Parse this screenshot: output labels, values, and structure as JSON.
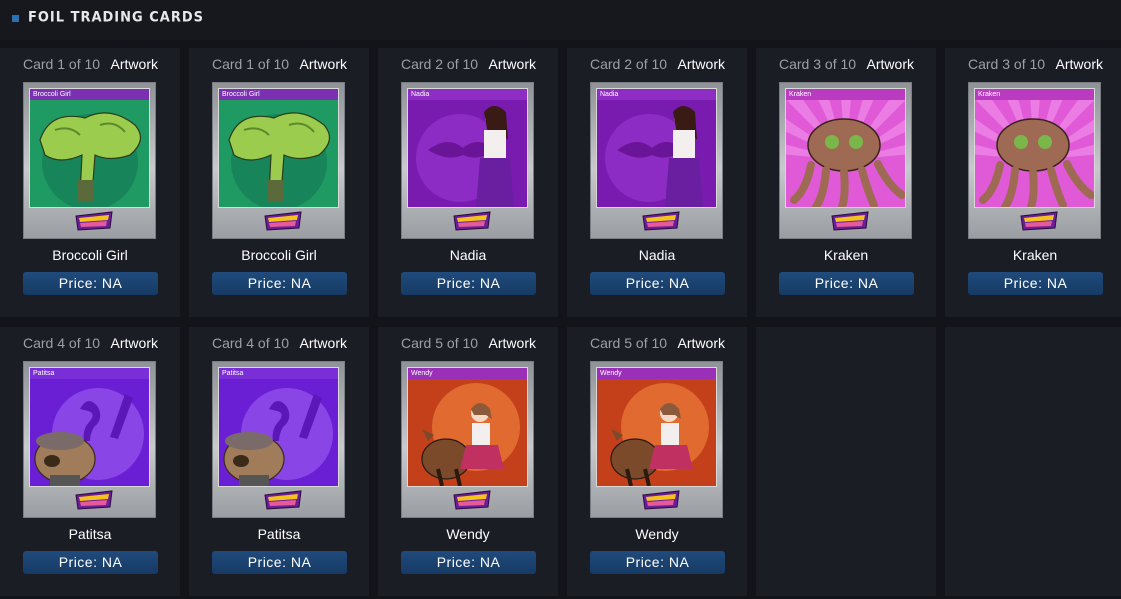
{
  "header": {
    "title": "FOIL TRADING CARDS"
  },
  "cards": [
    {
      "number": "Card 1 of 10",
      "artwork": "Artwork",
      "name": "Broccoli Girl",
      "price": "Price: NA",
      "theme": "broccoli",
      "bg": "#1f9a63",
      "bar": "#7b2fb1"
    },
    {
      "number": "Card 1 of 10",
      "artwork": "Artwork",
      "name": "Broccoli Girl",
      "price": "Price: NA",
      "theme": "broccoli",
      "bg": "#1f9a63",
      "bar": "#7b2fb1"
    },
    {
      "number": "Card 2 of 10",
      "artwork": "Artwork",
      "name": "Nadia",
      "price": "Price: NA",
      "theme": "nadia",
      "bg": "#7a1bb0",
      "bar": "#8e2dc4"
    },
    {
      "number": "Card 2 of 10",
      "artwork": "Artwork",
      "name": "Nadia",
      "price": "Price: NA",
      "theme": "nadia",
      "bg": "#7a1bb0",
      "bar": "#8e2dc4"
    },
    {
      "number": "Card 3 of 10",
      "artwork": "Artwork",
      "name": "Kraken",
      "price": "Price: NA",
      "theme": "kraken",
      "bg": "#e05ad8",
      "bar": "#b93cc0"
    },
    {
      "number": "Card 3 of 10",
      "artwork": "Artwork",
      "name": "Kraken",
      "price": "Price: NA",
      "theme": "kraken",
      "bg": "#e05ad8",
      "bar": "#b93cc0"
    },
    {
      "number": "Card 4 of 10",
      "artwork": "Artwork",
      "name": "Patitsa",
      "price": "Price: NA",
      "theme": "patitsa",
      "bg": "#6a1fd4",
      "bar": "#7a2ed8"
    },
    {
      "number": "Card 4 of 10",
      "artwork": "Artwork",
      "name": "Patitsa",
      "price": "Price: NA",
      "theme": "patitsa",
      "bg": "#6a1fd4",
      "bar": "#7a2ed8"
    },
    {
      "number": "Card 5 of 10",
      "artwork": "Artwork",
      "name": "Wendy",
      "price": "Price: NA",
      "theme": "wendy",
      "bg": "#c4401a",
      "bar": "#9a2fb8"
    },
    {
      "number": "Card 5 of 10",
      "artwork": "Artwork",
      "name": "Wendy",
      "price": "Price: NA",
      "theme": "wendy",
      "bg": "#c4401a",
      "bar": "#9a2fb8"
    }
  ]
}
